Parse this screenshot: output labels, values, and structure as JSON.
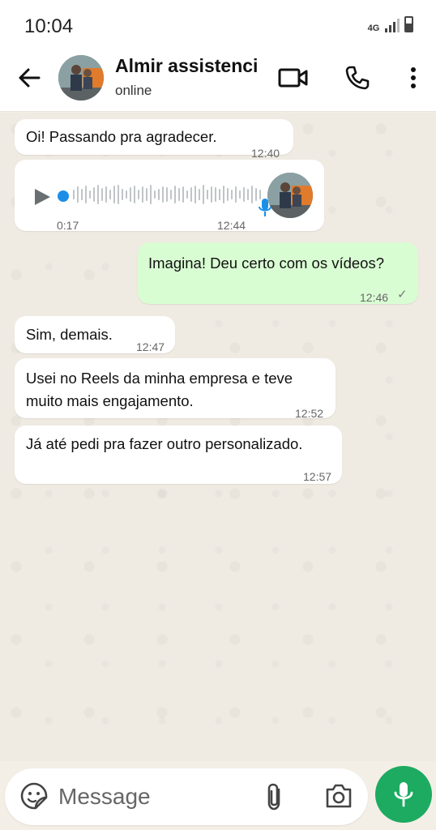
{
  "status_bar": {
    "time": "10:04",
    "network": "4G"
  },
  "header": {
    "contact_name": "Almir assistenci",
    "contact_status": "online",
    "icons": [
      "back-arrow-icon",
      "video-call-icon",
      "voice-call-icon",
      "more-options-icon"
    ]
  },
  "messages": [
    {
      "direction": "in",
      "text": "Oi! Passando pra agradecer.",
      "time": "12:40"
    },
    {
      "direction": "in",
      "type": "voice",
      "duration": "0:17",
      "time": "12:44"
    },
    {
      "direction": "out",
      "text": "Imagina! Deu certo com os vídeos?",
      "time": "12:46"
    },
    {
      "direction": "in",
      "text": "Sim, demais.",
      "time": "12:47"
    },
    {
      "direction": "in",
      "text_line1": "Usei no Reels da minha empresa e teve",
      "text_line2": "muito mais engajamento.",
      "time": "12:52"
    },
    {
      "direction": "in",
      "text": "Já até pedi pra fazer outro personalizado.",
      "time": "12:57"
    }
  ],
  "composer": {
    "placeholder": "Message"
  },
  "colors": {
    "accent": "#1daa61",
    "outgoing_bubble": "#d9fdd3",
    "voice_dot": "#1b8fe8"
  }
}
